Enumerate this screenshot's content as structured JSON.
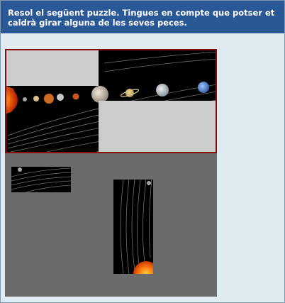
{
  "instructions": "Resol el següent puzzle. Tingues en compte que potser et caldrà girar alguna de les seves peces.",
  "colors": {
    "header_bg": "#2a5896",
    "page_bg": "#dfebf1",
    "board_border": "#8b0d0d",
    "empty_slot": "#cccccc",
    "tray_bg": "#6b6b6b"
  },
  "puzzle": {
    "image": "solar-system",
    "placed_pieces": 2,
    "empty_slots": 2,
    "loose_pieces": 2,
    "loose_piece_rotated": "right-piece"
  }
}
